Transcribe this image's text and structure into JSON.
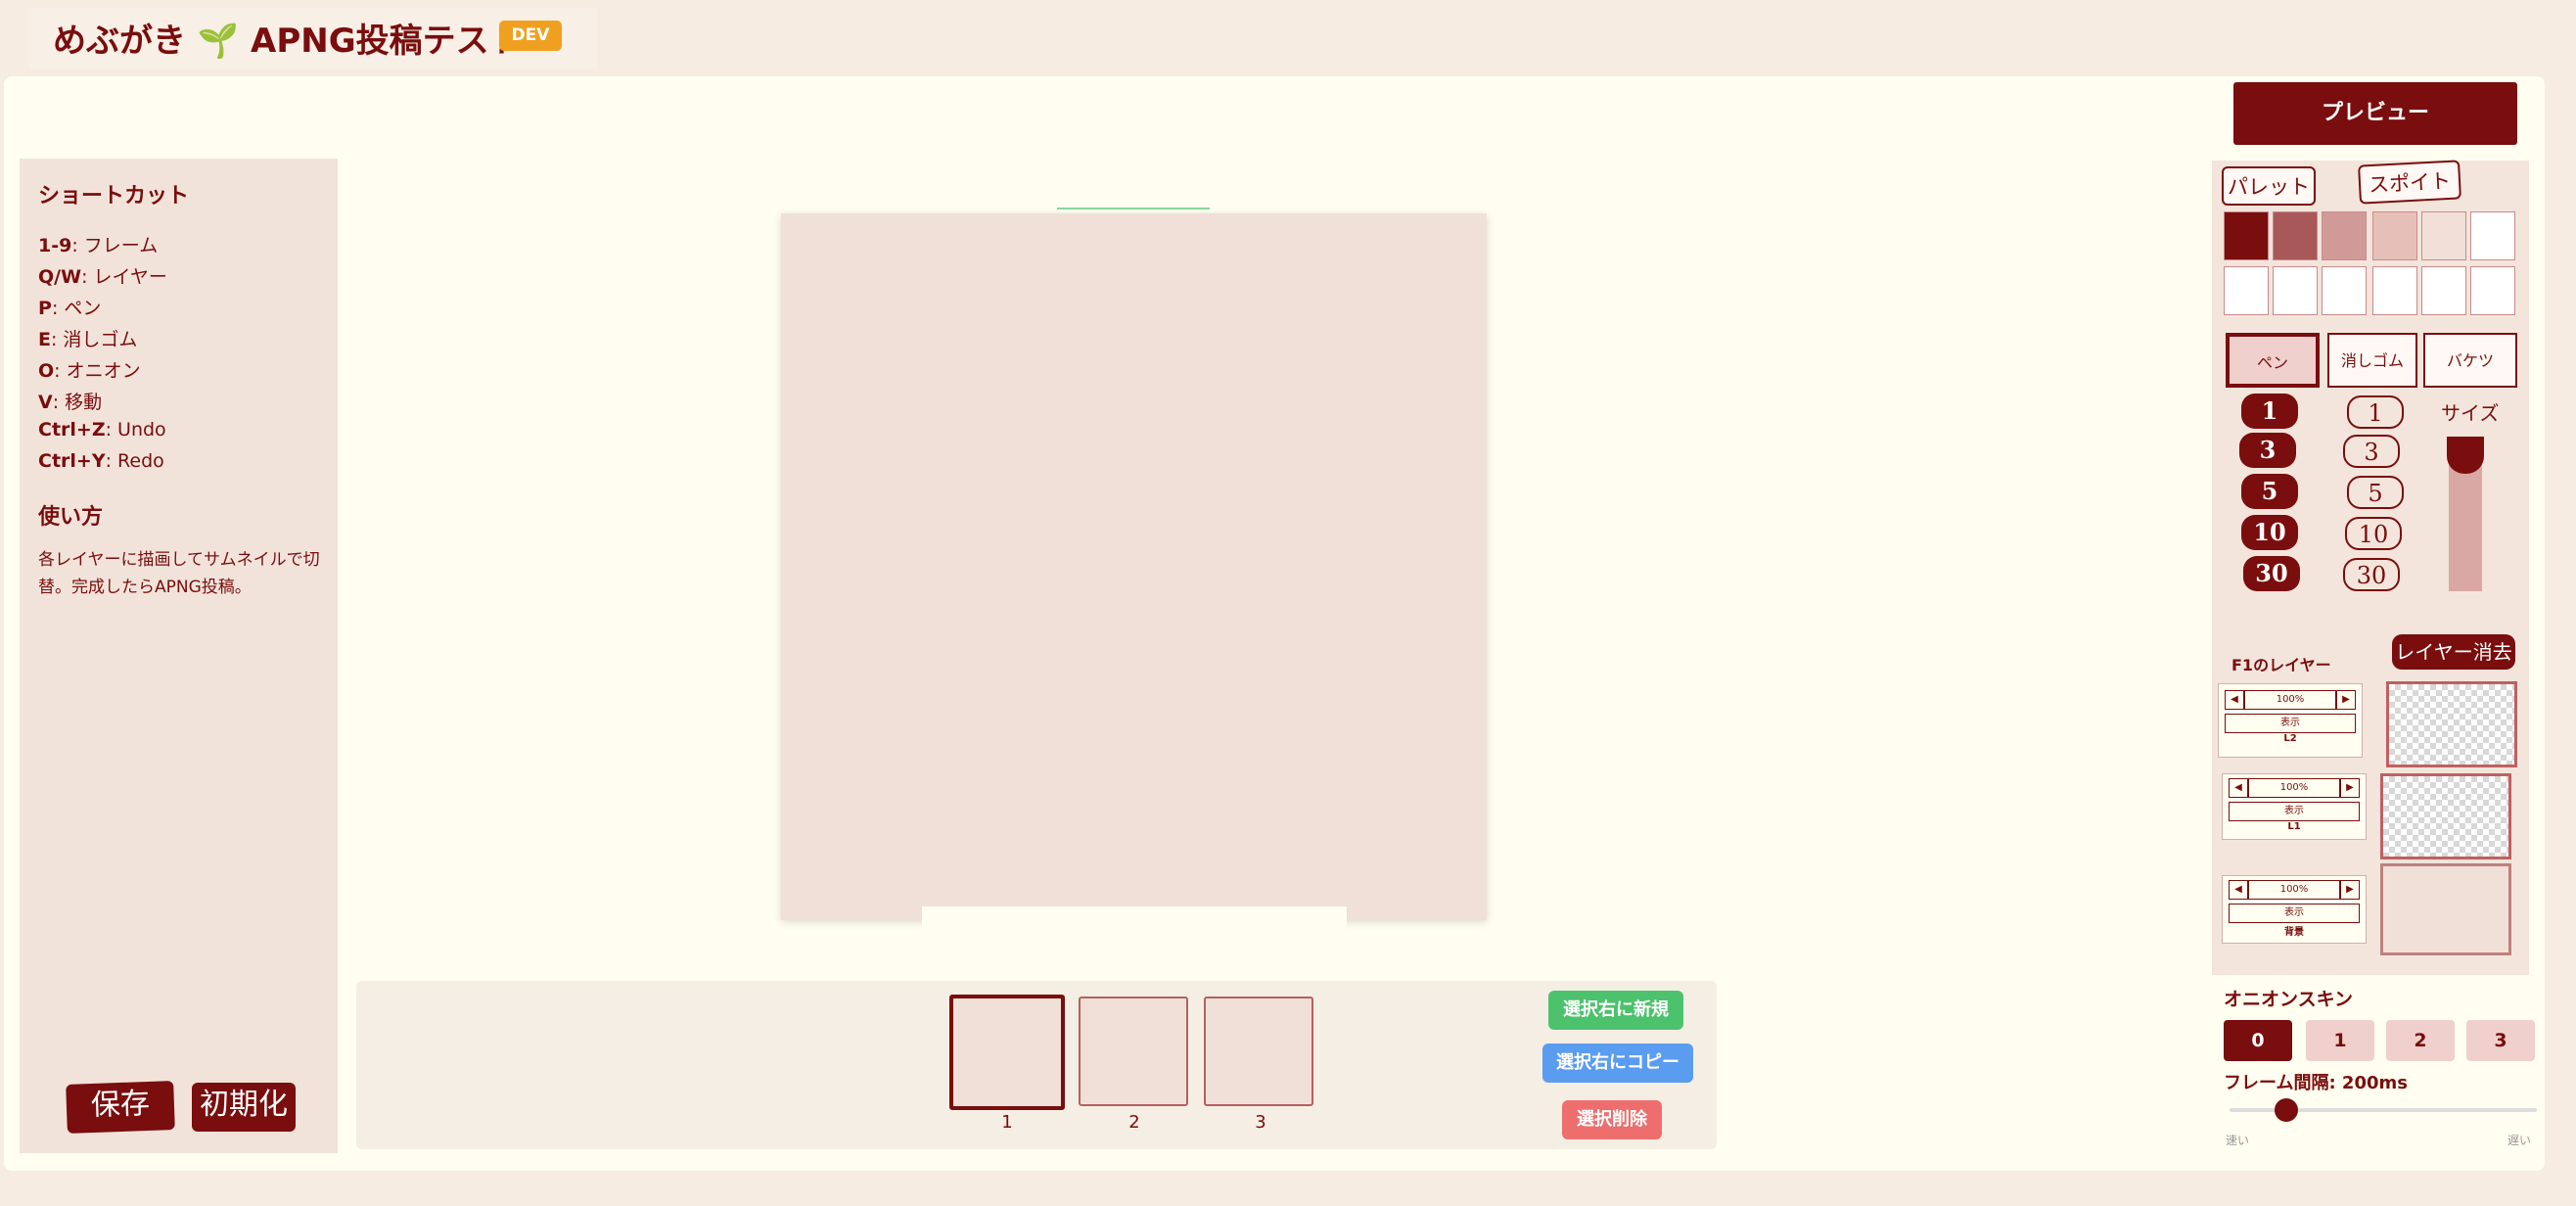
{
  "header": {
    "title": "めぶがき 🌱 APNG投稿テスト",
    "badge": "DEV"
  },
  "shortcuts": {
    "title": "ショートカット",
    "items": [
      {
        "key": "1-9",
        "desc": ": フレーム"
      },
      {
        "key": "Q/W",
        "desc": ": レイヤー"
      },
      {
        "key": "P",
        "desc": ": ペン"
      },
      {
        "key": "E",
        "desc": ": 消しゴム"
      },
      {
        "key": "O",
        "desc": ": オニオン"
      },
      {
        "key": "V",
        "desc": ": 移動"
      },
      {
        "key": "Ctrl+Z",
        "desc": ": Undo"
      },
      {
        "key": "Ctrl+Y",
        "desc": ": Redo"
      }
    ]
  },
  "usage": {
    "title": "使い方",
    "text": "各レイヤーに描画してサムネイルで切替。完成したらAPNG投稿。"
  },
  "left_buttons": {
    "save": "保存",
    "reset": "初期化"
  },
  "frames": {
    "labels": [
      "1",
      "2",
      "3"
    ],
    "selected": 0,
    "new_right": "選択右に新規",
    "copy_right": "選択右にコピー",
    "delete": "選択削除"
  },
  "right": {
    "preview": "プレビュー",
    "tab_palette": "パレット",
    "tab_eyedropper": "スポイト",
    "palette": [
      "#7a0d0d",
      "#a85858",
      "#d09a98",
      "#e6c0b8",
      "#f2e0d8",
      "#ffffff",
      "#ffffff",
      "#ffffff",
      "#ffffff",
      "#ffffff",
      "#ffffff",
      "#ffffff"
    ],
    "tools": [
      "ペン",
      "消しゴム",
      "バケツ"
    ],
    "selected_tool": 0,
    "sizes_filled": [
      "1",
      "3",
      "5",
      "10",
      "30"
    ],
    "sizes_outline": [
      "1",
      "3",
      "5",
      "10",
      "30"
    ],
    "size_label": "サイズ",
    "layers_title": "F1のレイヤー",
    "layer_delete": "レイヤー消去",
    "layers": [
      {
        "opacity": "100%",
        "show": "表示",
        "name": "L2"
      },
      {
        "opacity": "100%",
        "show": "表示",
        "name": "L1"
      },
      {
        "opacity": "100%",
        "show": "表示",
        "name": "背景"
      }
    ],
    "onion_title": "オニオンスキン",
    "onion_options": [
      "0",
      "1",
      "2",
      "3"
    ],
    "onion_selected": 0,
    "frame_interval": "フレーム間隔: 200ms",
    "interval_fast": "速い",
    "interval_slow": "遅い",
    "arrow_left": "◀",
    "arrow_right": "▶"
  }
}
